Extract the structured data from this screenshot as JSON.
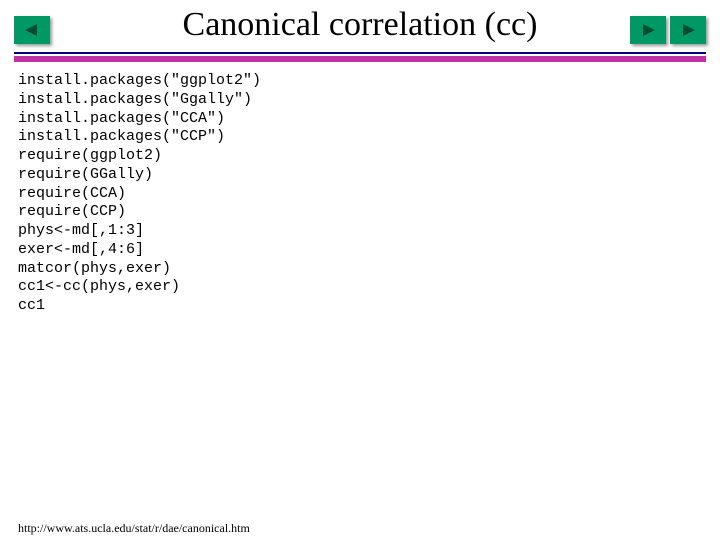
{
  "title": "Canonical correlation (cc)",
  "code": "install.packages(\"ggplot2\")\ninstall.packages(\"Ggally\")\ninstall.packages(\"CCA\")\ninstall.packages(\"CCP\")\nrequire(ggplot2)\nrequire(GGally)\nrequire(CCA)\nrequire(CCP)\nphys<-md[,1:3]\nexer<-md[,4:6]\nmatcor(phys,exer)\ncc1<-cc(phys,exer)\ncc1",
  "footer": "http://www.ats.ucla.edu/stat/r/dae/canonical.htm",
  "nav": {
    "prev_icon": "arrow-left-icon",
    "next_icon": "arrow-right-icon"
  }
}
